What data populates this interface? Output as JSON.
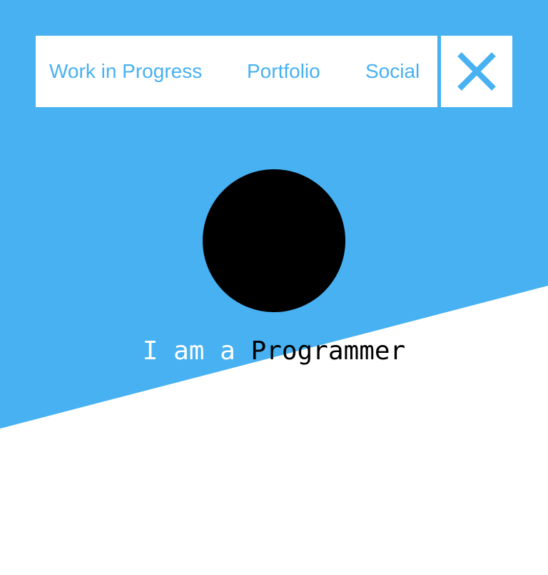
{
  "theme": {
    "accent": "#47b1f2",
    "background": "#ffffff",
    "avatar_fill": "#000000"
  },
  "nav": {
    "items": [
      {
        "label": "Work in Progress"
      },
      {
        "label": "Portfolio"
      },
      {
        "label": "Social"
      }
    ],
    "close_icon": "close-icon"
  },
  "hero": {
    "tagline_prefix": "I am a ",
    "tagline_role": "Programmer"
  }
}
